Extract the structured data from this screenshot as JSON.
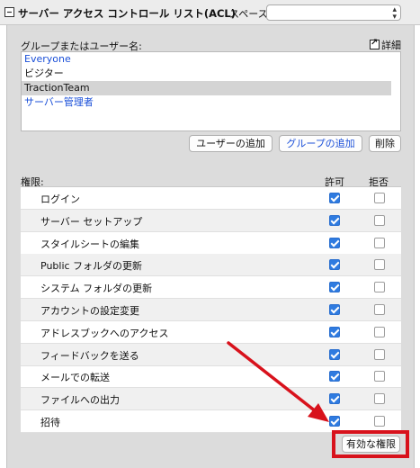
{
  "header": {
    "title": "サーバー アクセス コントロール リスト(ACL)",
    "space_label": "スペース",
    "space_value": ""
  },
  "groups": {
    "label": "グループまたはユーザー名:",
    "details_link": "詳細",
    "items": [
      {
        "name": "Everyone",
        "style": "link"
      },
      {
        "name": "ビジター",
        "style": "plain"
      },
      {
        "name": "TractionTeam",
        "style": "selected"
      },
      {
        "name": "サーバー管理者",
        "style": "link"
      }
    ],
    "buttons": {
      "add_user": "ユーザーの追加",
      "add_group": "グループの追加",
      "delete": "削除"
    }
  },
  "permissions": {
    "label": "権限:",
    "allow_header": "許可",
    "deny_header": "拒否",
    "rows": [
      {
        "label": "ログイン",
        "allow": true,
        "deny": false
      },
      {
        "label": "サーバー セットアップ",
        "allow": true,
        "deny": false
      },
      {
        "label": "スタイルシートの編集",
        "allow": true,
        "deny": false
      },
      {
        "label": "Public フォルダの更新",
        "allow": true,
        "deny": false
      },
      {
        "label": "システム フォルダの更新",
        "allow": true,
        "deny": false
      },
      {
        "label": "アカウントの設定変更",
        "allow": true,
        "deny": false
      },
      {
        "label": "アドレスブックへのアクセス",
        "allow": true,
        "deny": false
      },
      {
        "label": "フィードバックを送る",
        "allow": true,
        "deny": false
      },
      {
        "label": "メールでの転送",
        "allow": true,
        "deny": false
      },
      {
        "label": "ファイルへの出力",
        "allow": true,
        "deny": false
      },
      {
        "label": "招待",
        "allow": true,
        "deny": false
      }
    ],
    "effective_button": "有効な権限"
  },
  "colors": {
    "annotation": "#d8121c",
    "link": "#1a4fd8",
    "checkbox_checked": "#2f7be0"
  }
}
